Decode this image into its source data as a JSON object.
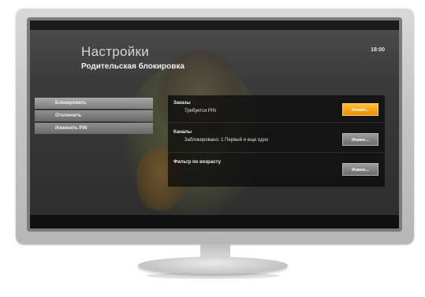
{
  "header": {
    "title": "Настройки",
    "subtitle": "Родительская блокировка",
    "clock": "18:00"
  },
  "menu": {
    "items": [
      {
        "label": "Блокировать",
        "selected": true
      },
      {
        "label": "Отключить",
        "selected": false
      },
      {
        "label": "Изменить PIN",
        "selected": false
      }
    ]
  },
  "settings": {
    "rows": [
      {
        "title": "Заказы",
        "detail": "Требуется PIN",
        "button": "Измен...",
        "active": true
      },
      {
        "title": "Каналы",
        "detail": "Заблокировано: 1 Первый и еще одно",
        "button": "Измен...",
        "active": false
      },
      {
        "title": "Фильтр по возрасту",
        "detail": "",
        "button": "Измен...",
        "active": false
      }
    ]
  },
  "colors": {
    "accent_button": "#f5a300",
    "panel_bg": "#0c0c0c",
    "menu_item": "#7a7a7a",
    "tv_frame": "#c8c8c8"
  }
}
